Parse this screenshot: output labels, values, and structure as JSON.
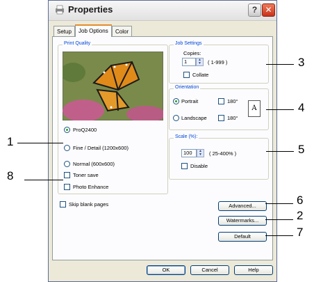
{
  "window": {
    "title": "Properties"
  },
  "tabs": [
    {
      "label": "Setup",
      "active": false
    },
    {
      "label": "Job Options",
      "active": true
    },
    {
      "label": "Color",
      "active": false
    }
  ],
  "print_quality": {
    "title": "Print Quality",
    "options": [
      {
        "label": "ProQ2400",
        "selected": true
      },
      {
        "label": "Fine / Detail (1200x600)",
        "selected": false
      },
      {
        "label": "Normal (600x600)",
        "selected": false
      }
    ],
    "toner_save": "Toner save",
    "photo_enhance": "Photo Enhance"
  },
  "skip_blank": "Skip blank pages",
  "job_settings": {
    "title": "Job Settings",
    "copies_label": "Copies:",
    "copies_value": "1",
    "copies_range": "( 1-999 )",
    "collate": "Collate"
  },
  "orientation": {
    "title": "Orientation",
    "portrait": "Portrait",
    "landscape": "Landscape",
    "rotate": "180°",
    "page_glyph": "A"
  },
  "scale": {
    "title": "Scale (%):",
    "value": "100",
    "range": "( 25-400% )",
    "disable": "Disable"
  },
  "buttons": {
    "advanced": "Advanced...",
    "watermarks": "Watermarks...",
    "default": "Default",
    "ok": "OK",
    "cancel": "Cancel",
    "help": "Help"
  },
  "callouts": {
    "c1": "1",
    "c2": "2",
    "c3": "3",
    "c4": "4",
    "c5": "5",
    "c6": "6",
    "c7": "7",
    "c8": "8"
  },
  "colors": {
    "accent_orange": "#e68b2c",
    "group_title_blue": "#0046d5",
    "dialog_bg": "#ece9d8"
  }
}
